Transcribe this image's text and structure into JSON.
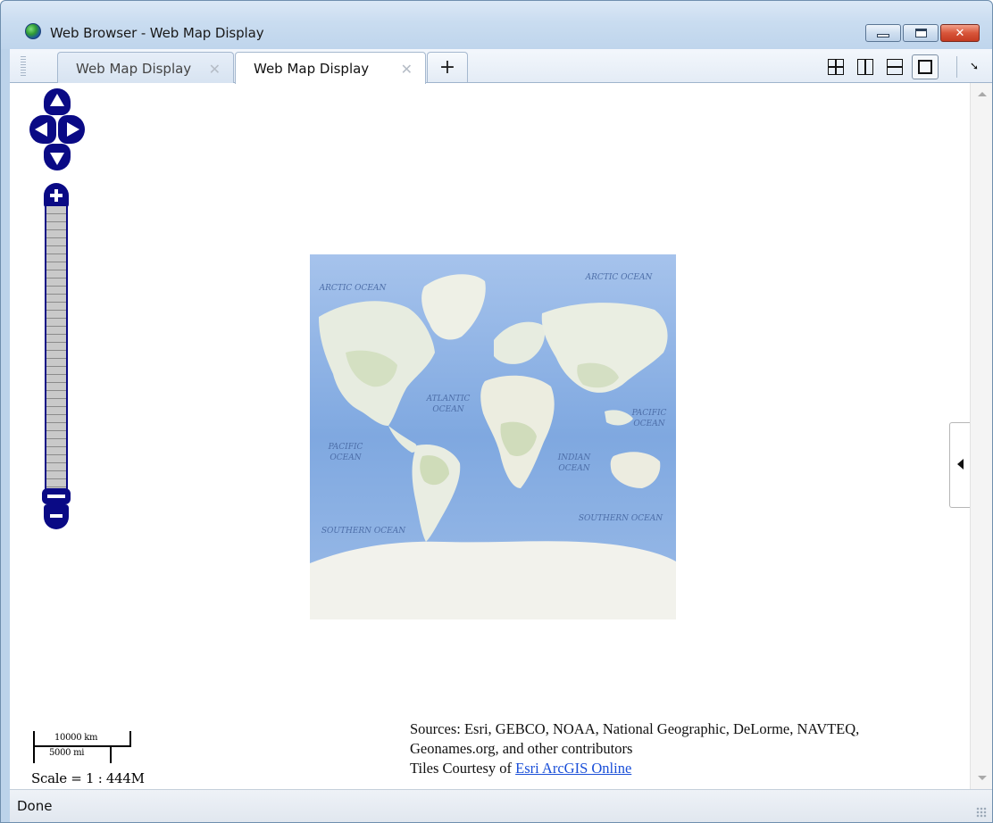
{
  "window": {
    "title": "Web Browser - Web Map Display",
    "close_glyph": "✕"
  },
  "tabs": [
    {
      "label": "Web Map Display",
      "active": false,
      "close_glyph": "✕"
    },
    {
      "label": "Web Map Display",
      "active": true,
      "close_glyph": "✕"
    }
  ],
  "new_tab_label": "+",
  "toolbar_icons": [
    "layout-grid-icon",
    "layout-columns-icon",
    "layout-rows-icon",
    "layout-single-icon",
    "undock-icon"
  ],
  "undock_glyph": "➘",
  "map": {
    "labels": {
      "arctic_left": "ARCTIC OCEAN",
      "arctic_right": "ARCTIC OCEAN",
      "atlantic_1": "ATLANTIC",
      "atlantic_2": "OCEAN",
      "pacific_left_1": "PACIFIC",
      "pacific_left_2": "OCEAN",
      "pacific_right_1": "PACIFIC",
      "pacific_right_2": "OCEAN",
      "indian_1": "INDIAN",
      "indian_2": "OCEAN",
      "southern_left": "SOUTHERN OCEAN",
      "southern_right": "SOUTHERN OCEAN"
    },
    "scale": {
      "km": "10000 km",
      "mi": "5000 mi",
      "ratio": "Scale = 1 : 444M"
    },
    "attribution": {
      "line1": "Sources: Esri, GEBCO, NOAA, National Geographic, DeLorme, NAVTEQ,",
      "line2": "Geonames.org, and other contributors",
      "line3_prefix": "Tiles Courtesy of ",
      "link": "Esri ArcGIS Online"
    },
    "colors": {
      "ocean": "#8fb4e6",
      "deep_ocean": "#6f9bd9",
      "land": "#eef0e4",
      "land_green": "#d6e2c4",
      "control_blue": "#0a0a85"
    }
  },
  "status": {
    "text": "Done"
  }
}
